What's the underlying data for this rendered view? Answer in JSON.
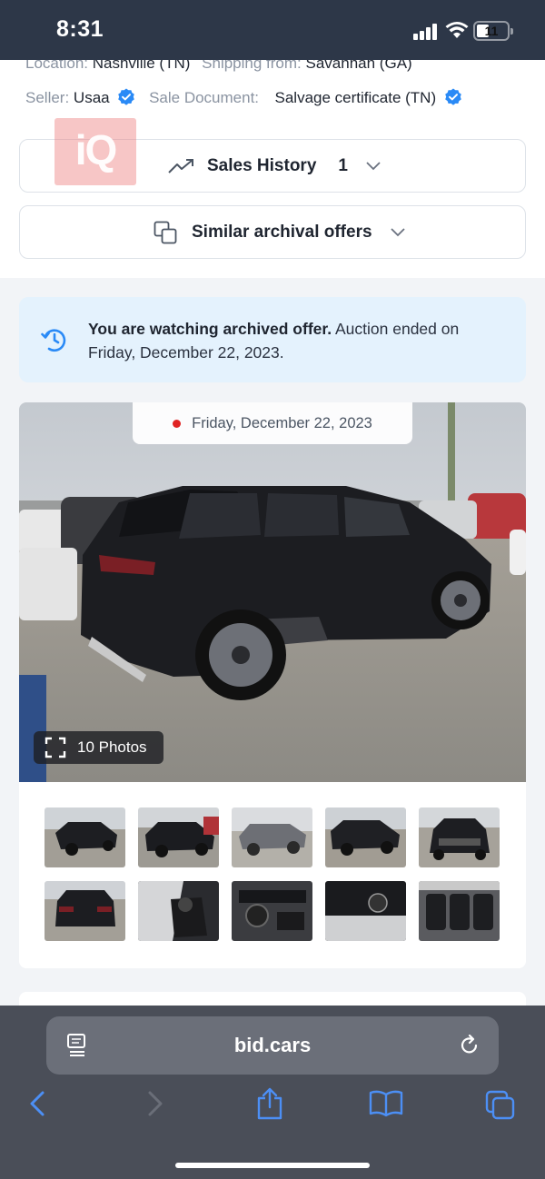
{
  "status_bar": {
    "time": "8:31",
    "battery": "11"
  },
  "listing": {
    "location_label": "Location:",
    "location": "Nashville (TN)",
    "shipping_label": "Shipping from:",
    "shipping": "Savannah (GA)",
    "seller_label": "Seller:",
    "seller": "Usaa",
    "sale_doc_label": "Sale Document:",
    "sale_doc": "Salvage certificate (TN)"
  },
  "logo": {
    "text": "iQ"
  },
  "sales_history": {
    "label": "Sales History",
    "count": "1"
  },
  "similar": {
    "label": "Similar archival offers"
  },
  "notice": {
    "bold": "You are watching archived offer.",
    "rest": " Auction ended on Friday, December 22, 2023."
  },
  "gallery": {
    "date": "Friday, December 22, 2023",
    "photos_label": "10 Photos",
    "thumbnails": [
      "rear-left view",
      "rear-left side",
      "front-right view",
      "front-right view",
      "front view",
      "rear view",
      "driver seat interior",
      "dashboard interior",
      "engine start button",
      "rear seats interior"
    ]
  },
  "browser": {
    "url": "bid.cars"
  },
  "colors": {
    "accent": "#2a8af6",
    "status_bar": "#2d3748",
    "safari_bar": "#4a4e58",
    "notice_bg": "#e4f2fd"
  },
  "icons": [
    "cell-signal-icon",
    "wifi-icon",
    "battery-icon",
    "verified-icon",
    "trend-up-icon",
    "chevron-down-icon",
    "copy-icon",
    "history-icon",
    "fullscreen-icon",
    "reader-icon",
    "reload-icon",
    "back-icon",
    "forward-icon",
    "share-icon",
    "bookmarks-icon",
    "tabs-icon"
  ]
}
